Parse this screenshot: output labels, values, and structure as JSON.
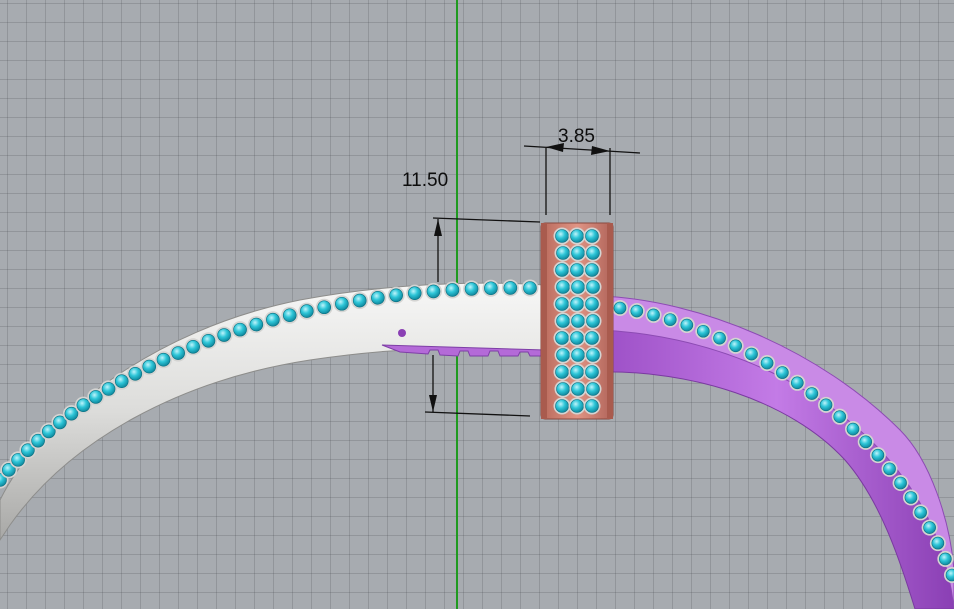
{
  "viewport": {
    "background_color": "#a7abb0",
    "grid_color": "#6e7178",
    "axis_color": "#1f9a1f"
  },
  "dimensions": {
    "width_value": "3.85",
    "height_value": "11.50"
  },
  "model": {
    "white_band_color": "#e2e2e0",
    "purple_band_color": "#b264d8",
    "collar_color": "#cf7f6e",
    "gem_color": "#2ec6d8",
    "gem_count_white_band": 36,
    "gem_count_purple_band": 26,
    "collar_gem_rows": 3,
    "collar_gems_per_row": 11
  }
}
